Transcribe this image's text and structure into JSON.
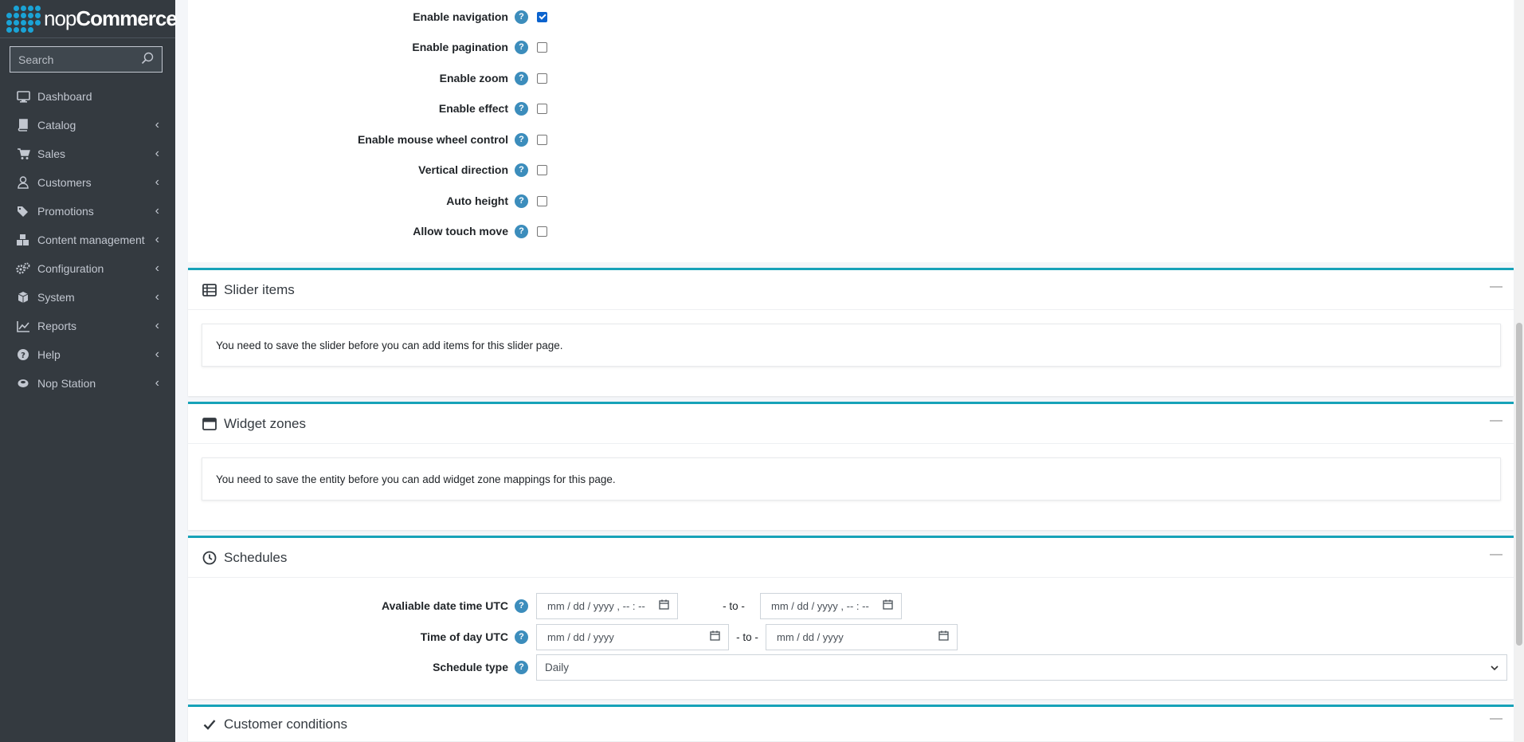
{
  "brand": {
    "name_part1": "nop",
    "name_part2": "Commerce"
  },
  "search": {
    "placeholder": "Search",
    "icon": "search-icon"
  },
  "sidebar": {
    "items": [
      {
        "label": "Dashboard",
        "icon": "desktop-icon",
        "has_children": false
      },
      {
        "label": "Catalog",
        "icon": "book-icon",
        "has_children": true
      },
      {
        "label": "Sales",
        "icon": "cart-icon",
        "has_children": true
      },
      {
        "label": "Customers",
        "icon": "user-icon",
        "has_children": true
      },
      {
        "label": "Promotions",
        "icon": "tags-icon",
        "has_children": true
      },
      {
        "label": "Content management",
        "icon": "cubes-icon",
        "has_children": true
      },
      {
        "label": "Configuration",
        "icon": "cogs-icon",
        "has_children": true
      },
      {
        "label": "System",
        "icon": "cube-icon",
        "has_children": true
      },
      {
        "label": "Reports",
        "icon": "chart-line-icon",
        "has_children": true
      },
      {
        "label": "Help",
        "icon": "question-circle-icon",
        "has_children": true
      },
      {
        "label": "Nop Station",
        "icon": "nopstation-icon",
        "has_children": true
      }
    ]
  },
  "settings": {
    "fields": [
      {
        "label": "Enable navigation",
        "checked": true
      },
      {
        "label": "Enable pagination",
        "checked": false
      },
      {
        "label": "Enable zoom",
        "checked": false
      },
      {
        "label": "Enable effect",
        "checked": false
      },
      {
        "label": "Enable mouse wheel control",
        "checked": false
      },
      {
        "label": "Vertical direction",
        "checked": false
      },
      {
        "label": "Auto height",
        "checked": false
      },
      {
        "label": "Allow touch move",
        "checked": false
      }
    ]
  },
  "slider_items": {
    "title": "Slider items",
    "notice": "You need to save the slider before you can add items for this slider page."
  },
  "widget_zones": {
    "title": "Widget zones",
    "notice": "You need to save the entity before you can add widget zone mappings for this page."
  },
  "schedules": {
    "title": "Schedules",
    "available_label": "Avaliable date time UTC",
    "available_from_placeholder": "mm / dd / yyyy ,  -- : --",
    "available_to_placeholder": "mm / dd / yyyy ,  -- : --",
    "to_text": "- to -",
    "time_of_day_label": "Time of day UTC",
    "time_from_placeholder": "mm / dd / yyyy",
    "time_to_placeholder": "mm / dd / yyyy",
    "schedule_type_label": "Schedule type",
    "schedule_type_value": "Daily"
  },
  "customer_conditions": {
    "title": "Customer conditions"
  },
  "help_glyph": "?",
  "colors": {
    "sidebar_bg": "#343a40",
    "accent": "#17a2b8",
    "help": "#3c8dbc",
    "checkbox_checked": "#0b63ce"
  }
}
